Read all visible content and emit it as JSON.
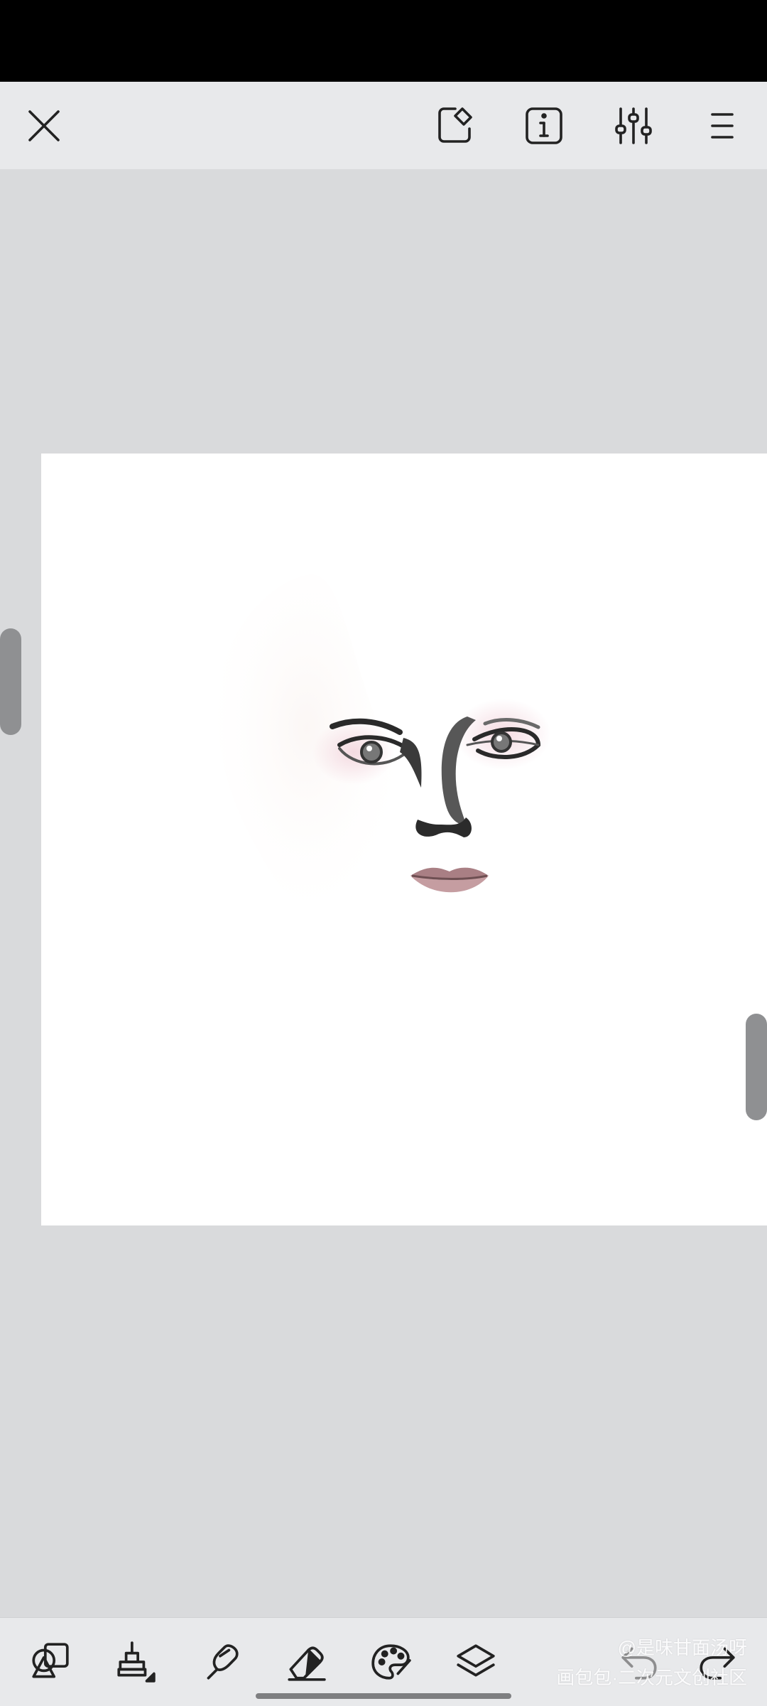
{
  "top_toolbar": {
    "icons": [
      "close-icon",
      "canvas-tools-icon",
      "info-icon",
      "adjustments-icon",
      "menu-icon"
    ]
  },
  "bottom_toolbar": {
    "icons": [
      "shapes-icon",
      "stamp-icon",
      "smudge-icon",
      "eraser-icon",
      "palette-icon",
      "layers-icon",
      "undo-icon",
      "redo-icon"
    ]
  },
  "watermark": {
    "line1": "@是味甘面汤呀",
    "line2": "画包包·二次元文创社区"
  },
  "colors": {
    "status_bar": "#000000",
    "toolbar_bg": "#e8e9eb",
    "workspace_bg": "#d9dadc",
    "canvas_bg": "#ffffff",
    "lip_color": "#b0888c"
  }
}
